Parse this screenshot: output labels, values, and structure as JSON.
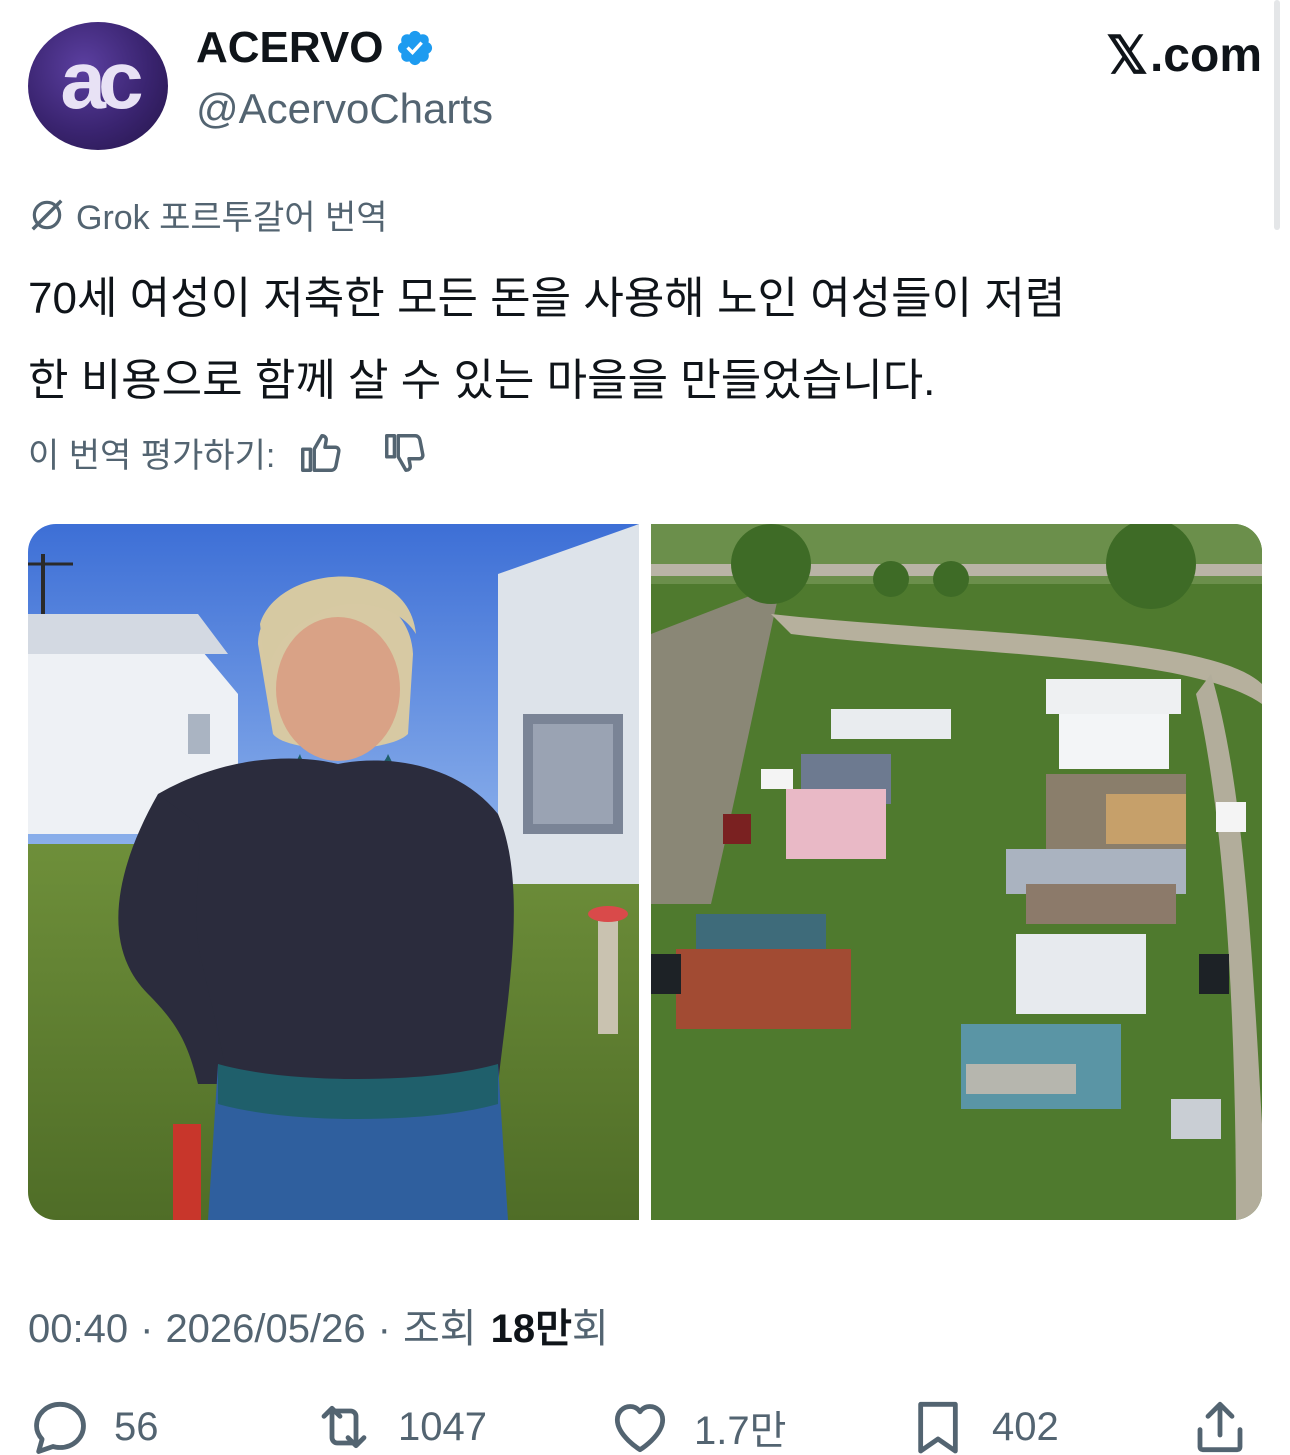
{
  "author": {
    "avatar_text": "ac",
    "display_name": "ACERVO",
    "handle": "@AcervoCharts",
    "verified_icon": "verified-badge-icon",
    "brand": "𝕏.com",
    "brand_x": "𝕏",
    "brand_suffix": ".com"
  },
  "translation": {
    "label": "Grok 포르투갈어 번역",
    "icon": "grok-icon",
    "text_line1": "70세 여성이 저축한 모든 돈을 사용해 노인 여성들이 저렴",
    "text_line2": "한 비용으로 함께 살 수 있는 마을을 만들었습니다.",
    "rate_label": "이 번역 평가하기:"
  },
  "media": {
    "count": 2
  },
  "meta": {
    "time": "00:40",
    "date": "2026/05/26",
    "views_prefix": "조회",
    "views_value": "18만",
    "views_suffix": "회"
  },
  "actions": {
    "replies": "56",
    "reposts": "1047",
    "likes": "1.7만",
    "bookmarks": "402"
  },
  "colors": {
    "accent_blue": "#1d9bf0",
    "muted": "#536471",
    "text": "#0f1419"
  }
}
